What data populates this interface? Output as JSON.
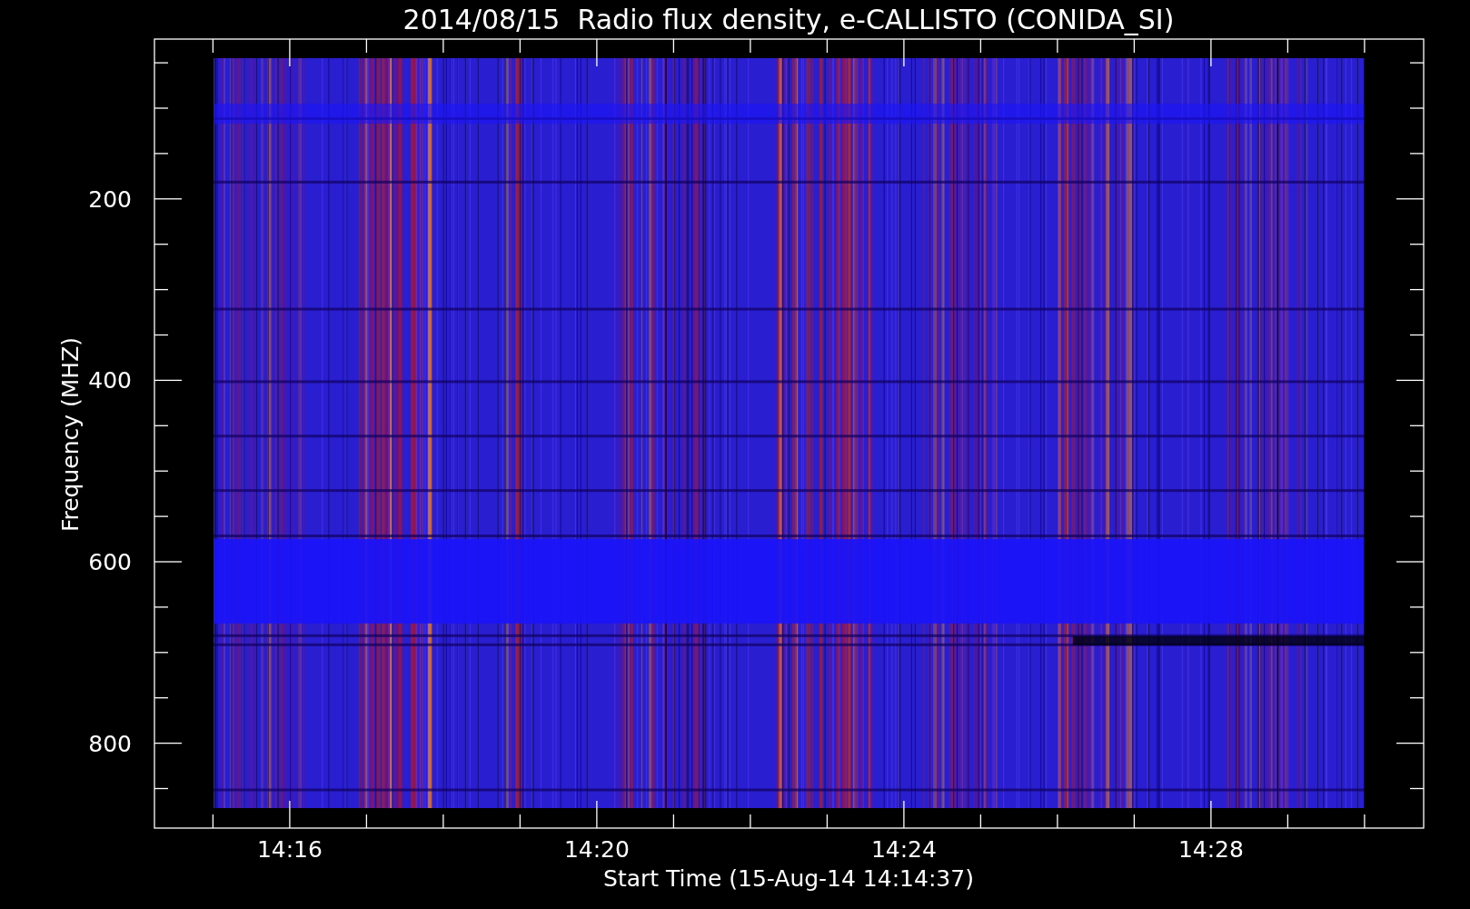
{
  "plot": {
    "title": "2014/08/15  Radio flux density, e-CALLISTO (CONIDA_SI)",
    "xlabel": "Start Time (15-Aug-14 14:14:37)",
    "ylabel": "Frequency (MHZ)",
    "xtick_labels": [
      "14:16",
      "14:20",
      "14:24",
      "14:28"
    ],
    "ytick_labels": [
      "200",
      "400",
      "600",
      "800"
    ]
  }
}
